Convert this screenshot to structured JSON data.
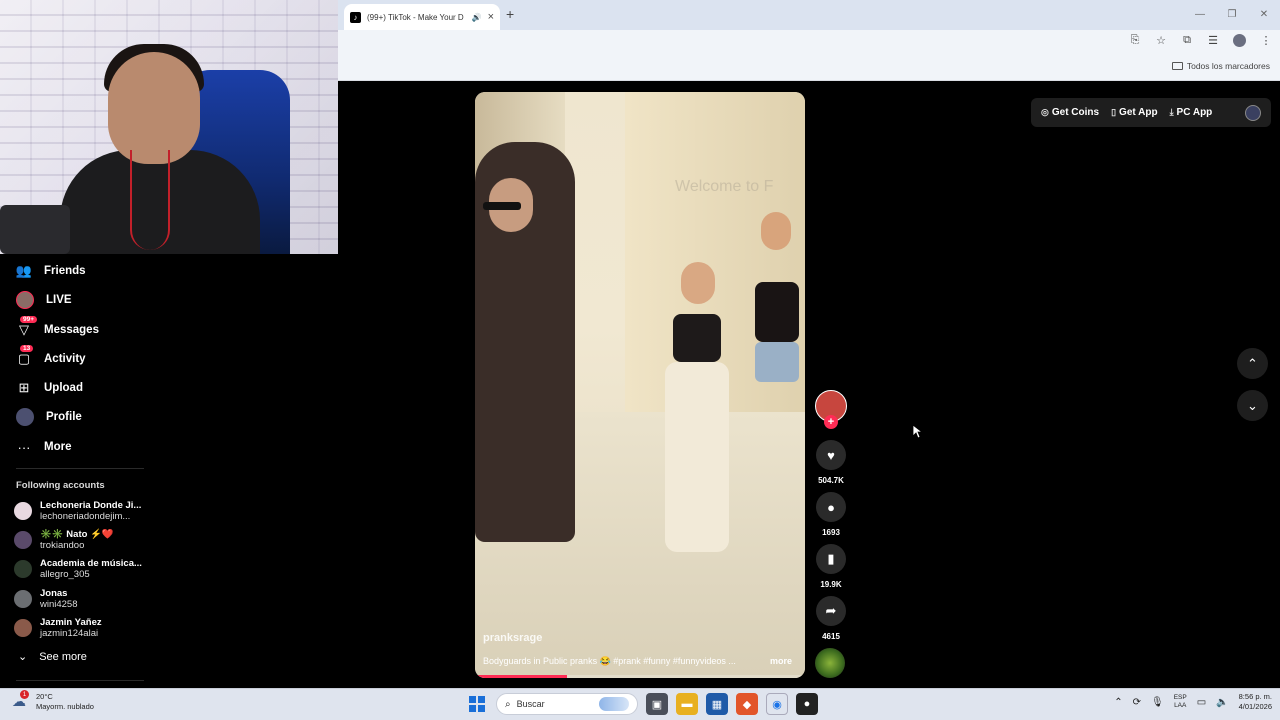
{
  "browser": {
    "tab_title": "(99+) TikTok - Make Your D",
    "bookmarks_folder": "Todos los marcadores"
  },
  "sidebar": {
    "items": [
      {
        "label": "Friends",
        "icon": "friends-icon"
      },
      {
        "label": "LIVE",
        "icon": "live-avatar"
      },
      {
        "label": "Messages",
        "icon": "messages-icon",
        "badge": "99+"
      },
      {
        "label": "Activity",
        "icon": "activity-icon",
        "badge": "13"
      },
      {
        "label": "Upload",
        "icon": "upload-icon"
      },
      {
        "label": "Profile",
        "icon": "profile-avatar"
      },
      {
        "label": "More",
        "icon": "more-icon"
      }
    ],
    "following_title": "Following accounts",
    "accounts": [
      {
        "name": "Lechoneria Donde Ji...",
        "handle": "lechoneriadondejim...",
        "color": "#e8d8e0"
      },
      {
        "name": "✳️✳️ Nato ⚡️❤️",
        "handle": "trokiandoo",
        "color": "#5a4a6a"
      },
      {
        "name": "Academia de música...",
        "handle": "allegro_305",
        "color": "#2c3a2c"
      },
      {
        "name": "Jonas",
        "handle": "wini4258",
        "color": "#6b6e72"
      },
      {
        "name": "Jazmin Yañez",
        "handle": "jazmin124alai",
        "color": "#8a5a4a"
      }
    ],
    "see_more": "See more"
  },
  "top_actions": {
    "get_coins": "Get Coins",
    "get_app": "Get App",
    "pc_app": "PC App"
  },
  "video": {
    "overlay_text": "Welcome to F",
    "username": "pranksrage",
    "caption": "Bodyguards in Public pranks 😂 #prank #funny #funnyvideos ...",
    "more": "more",
    "progress": 0.28
  },
  "rail": {
    "likes": "504.7K",
    "comments": "1693",
    "saves": "19.9K",
    "shares": "4615"
  },
  "taskbar": {
    "temperature": "20°C",
    "weather": "Mayorm. nublado",
    "weather_badge": "1",
    "search_placeholder": "Buscar",
    "lang_top": "ESP",
    "lang_bottom": "LAA",
    "time": "8:56 p. m.",
    "date": "4/01/2026"
  },
  "colors": {
    "accent": "#fe2c55"
  }
}
